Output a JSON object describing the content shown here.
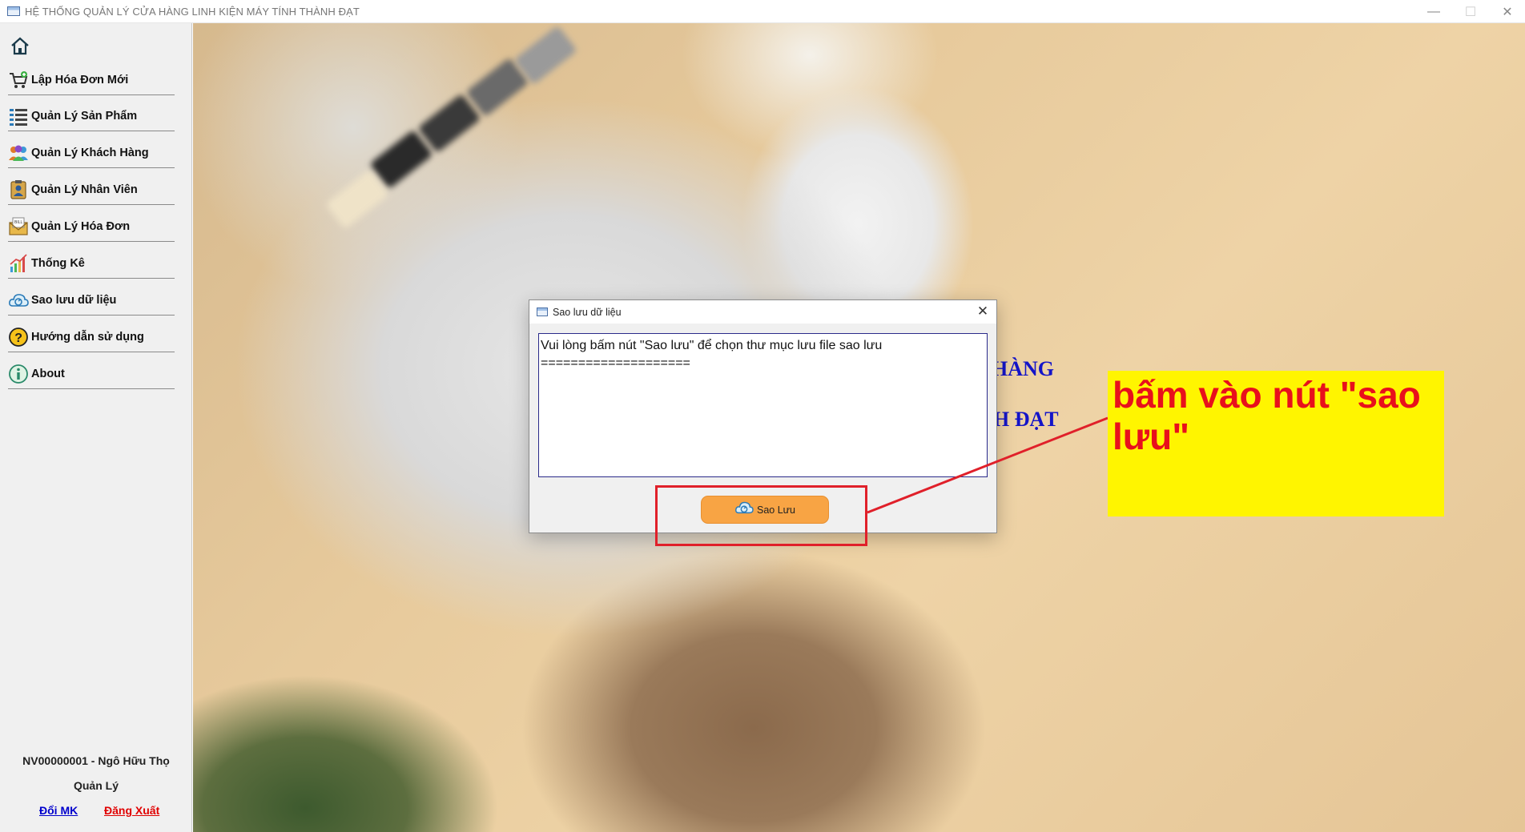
{
  "window": {
    "title": "HỆ THỐNG QUẢN LÝ CỬA HÀNG LINH KIỆN MÁY TÍNH THÀNH ĐẠT",
    "minimize_glyph": "—",
    "maximize_glyph": "☐",
    "close_glyph": "✕"
  },
  "sidebar": {
    "items": [
      {
        "label": "Lập Hóa Đơn Mới",
        "icon": "cart-icon"
      },
      {
        "label": "Quản Lý Sản Phẩm",
        "icon": "list-icon"
      },
      {
        "label": "Quản Lý Khách Hàng",
        "icon": "customers-icon"
      },
      {
        "label": "Quản Lý Nhân Viên",
        "icon": "employee-badge-icon"
      },
      {
        "label": "Quản Lý Hóa Đơn",
        "icon": "bill-envelope-icon"
      },
      {
        "label": "Thống Kê",
        "icon": "chart-icon"
      },
      {
        "label": "Sao lưu dữ liệu",
        "icon": "cloud-backup-icon"
      },
      {
        "label": "Hướng dẫn sử dụng",
        "icon": "help-icon"
      },
      {
        "label": "About",
        "icon": "info-icon"
      }
    ],
    "user": "NV00000001 - Ngô Hữu  Thọ",
    "role": "Quản Lý",
    "change_password": "Đổi MK",
    "logout": "Đăng Xuất"
  },
  "background": {
    "heading_line1": "HÀNG",
    "heading_line2": "H ĐẠT"
  },
  "dialog": {
    "title": "Sao lưu dữ liệu",
    "close_glyph": "✕",
    "message": "Vui lòng bấm nút \"Sao lưu\" để chọn thư mục lưu file sao lưu\n====================",
    "button_label": "Sao Lưu"
  },
  "annotation": {
    "note": "bấm vào nút \"sao lưu\""
  },
  "colors": {
    "accent_button": "#f8a444",
    "annotation_red": "#e0202a",
    "annotation_yellow": "#fff500",
    "logout_red": "#e00000",
    "link_blue": "#0000cc"
  }
}
